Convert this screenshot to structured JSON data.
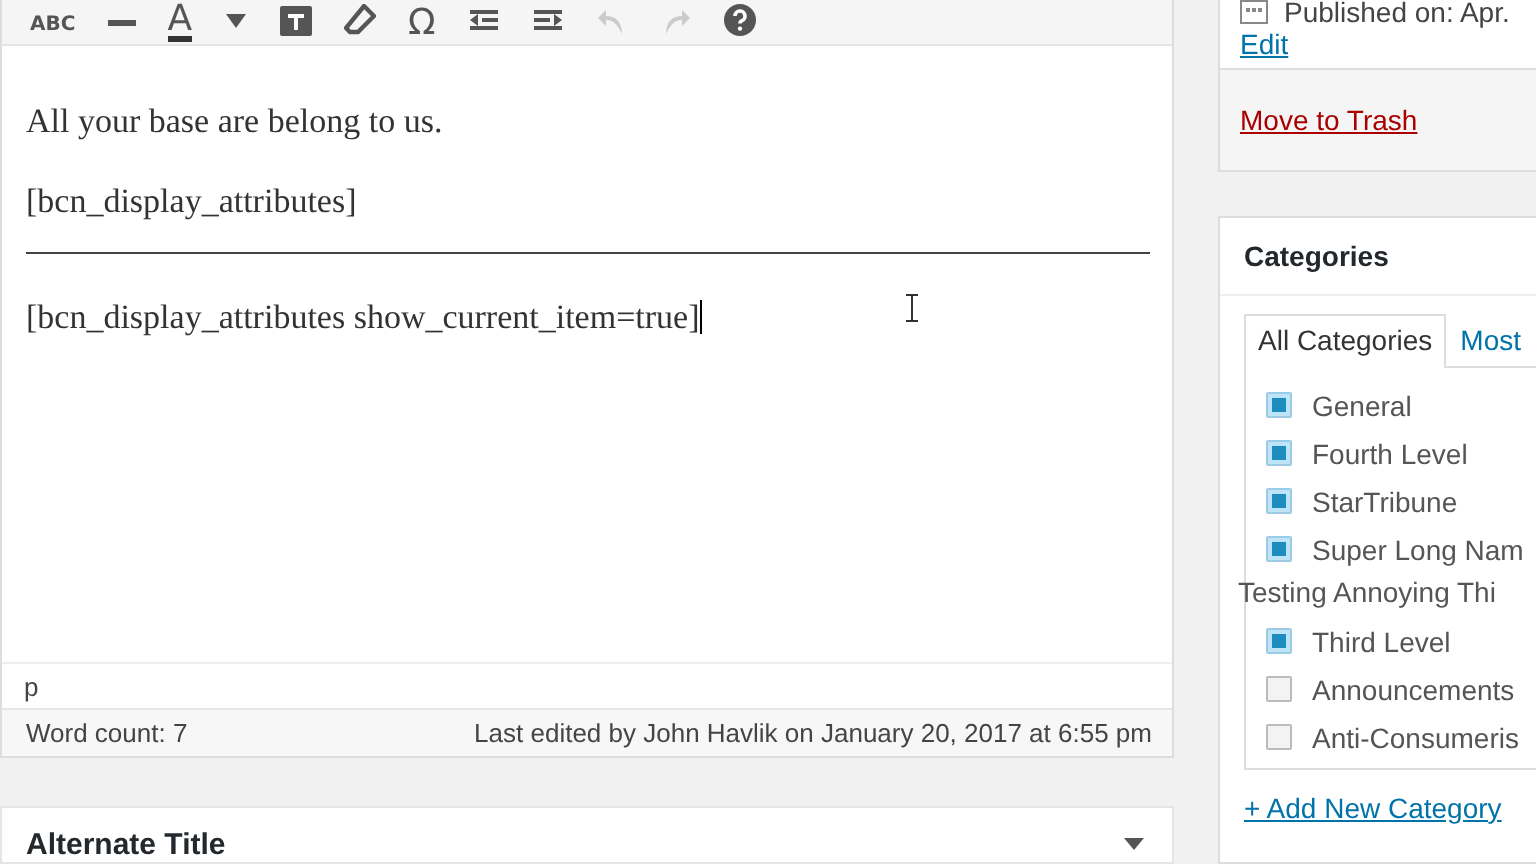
{
  "toolbar": [
    {
      "kind": "glyph",
      "text": "ABC",
      "disabled": false
    },
    {
      "kind": "hr",
      "disabled": false
    },
    {
      "kind": "color",
      "text": "A",
      "disabled": false
    },
    {
      "kind": "caret",
      "disabled": false
    },
    {
      "kind": "paste",
      "disabled": false
    },
    {
      "kind": "eraser",
      "disabled": false
    },
    {
      "kind": "glyph",
      "text": "Ω",
      "disabled": false
    },
    {
      "kind": "outdent",
      "disabled": false
    },
    {
      "kind": "indent",
      "disabled": false
    },
    {
      "kind": "undo",
      "disabled": true
    },
    {
      "kind": "redo",
      "disabled": true
    },
    {
      "kind": "help",
      "disabled": false
    }
  ],
  "editor": {
    "blocks": [
      {
        "kind": "p",
        "text": "All your base are belong to us."
      },
      {
        "kind": "p",
        "text": "[bcn_display_attributes]"
      },
      {
        "kind": "hr"
      },
      {
        "kind": "p",
        "text": "[bcn_display_attributes show_current_item=true]"
      }
    ],
    "path": "p",
    "word_count": "Word count: 7",
    "last_edited": "Last edited by John Havlik on January 20, 2017 at 6:55 pm"
  },
  "alternate_title": {
    "title": "Alternate Title"
  },
  "publish": {
    "published": "Published on: Apr.",
    "edit_link": "Edit",
    "trash_link": "Move to Trash"
  },
  "categories": {
    "title": "Categories",
    "tabs": [
      {
        "label": "All Categories",
        "selected": true
      },
      {
        "label": "Most",
        "selected": false
      }
    ],
    "items": [
      {
        "lines": [
          "General"
        ],
        "checked": true
      },
      {
        "lines": [
          "Fourth Level"
        ],
        "checked": true
      },
      {
        "lines": [
          "StarTribune"
        ],
        "checked": true
      },
      {
        "lines": [
          "Super Long Nam",
          "Testing Annoying Thi"
        ],
        "checked": true
      },
      {
        "lines": [
          "Third Level"
        ],
        "checked": true
      },
      {
        "lines": [
          "Announcements"
        ],
        "checked": false
      },
      {
        "lines": [
          "Anti-Consumeris"
        ],
        "checked": false
      }
    ],
    "add_link": "+ Add New Category"
  }
}
